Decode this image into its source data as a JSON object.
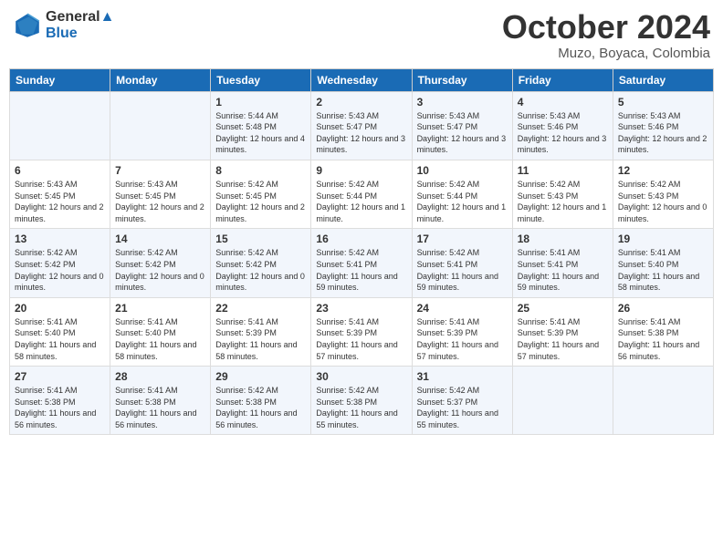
{
  "logo": {
    "line1": "General",
    "line2": "Blue"
  },
  "title": "October 2024",
  "subtitle": "Muzo, Boyaca, Colombia",
  "days_of_week": [
    "Sunday",
    "Monday",
    "Tuesday",
    "Wednesday",
    "Thursday",
    "Friday",
    "Saturday"
  ],
  "weeks": [
    [
      {
        "day": "",
        "sunrise": "",
        "sunset": "",
        "daylight": ""
      },
      {
        "day": "",
        "sunrise": "",
        "sunset": "",
        "daylight": ""
      },
      {
        "day": "1",
        "sunrise": "Sunrise: 5:44 AM",
        "sunset": "Sunset: 5:48 PM",
        "daylight": "Daylight: 12 hours and 4 minutes."
      },
      {
        "day": "2",
        "sunrise": "Sunrise: 5:43 AM",
        "sunset": "Sunset: 5:47 PM",
        "daylight": "Daylight: 12 hours and 3 minutes."
      },
      {
        "day": "3",
        "sunrise": "Sunrise: 5:43 AM",
        "sunset": "Sunset: 5:47 PM",
        "daylight": "Daylight: 12 hours and 3 minutes."
      },
      {
        "day": "4",
        "sunrise": "Sunrise: 5:43 AM",
        "sunset": "Sunset: 5:46 PM",
        "daylight": "Daylight: 12 hours and 3 minutes."
      },
      {
        "day": "5",
        "sunrise": "Sunrise: 5:43 AM",
        "sunset": "Sunset: 5:46 PM",
        "daylight": "Daylight: 12 hours and 2 minutes."
      }
    ],
    [
      {
        "day": "6",
        "sunrise": "Sunrise: 5:43 AM",
        "sunset": "Sunset: 5:45 PM",
        "daylight": "Daylight: 12 hours and 2 minutes."
      },
      {
        "day": "7",
        "sunrise": "Sunrise: 5:43 AM",
        "sunset": "Sunset: 5:45 PM",
        "daylight": "Daylight: 12 hours and 2 minutes."
      },
      {
        "day": "8",
        "sunrise": "Sunrise: 5:42 AM",
        "sunset": "Sunset: 5:45 PM",
        "daylight": "Daylight: 12 hours and 2 minutes."
      },
      {
        "day": "9",
        "sunrise": "Sunrise: 5:42 AM",
        "sunset": "Sunset: 5:44 PM",
        "daylight": "Daylight: 12 hours and 1 minute."
      },
      {
        "day": "10",
        "sunrise": "Sunrise: 5:42 AM",
        "sunset": "Sunset: 5:44 PM",
        "daylight": "Daylight: 12 hours and 1 minute."
      },
      {
        "day": "11",
        "sunrise": "Sunrise: 5:42 AM",
        "sunset": "Sunset: 5:43 PM",
        "daylight": "Daylight: 12 hours and 1 minute."
      },
      {
        "day": "12",
        "sunrise": "Sunrise: 5:42 AM",
        "sunset": "Sunset: 5:43 PM",
        "daylight": "Daylight: 12 hours and 0 minutes."
      }
    ],
    [
      {
        "day": "13",
        "sunrise": "Sunrise: 5:42 AM",
        "sunset": "Sunset: 5:42 PM",
        "daylight": "Daylight: 12 hours and 0 minutes."
      },
      {
        "day": "14",
        "sunrise": "Sunrise: 5:42 AM",
        "sunset": "Sunset: 5:42 PM",
        "daylight": "Daylight: 12 hours and 0 minutes."
      },
      {
        "day": "15",
        "sunrise": "Sunrise: 5:42 AM",
        "sunset": "Sunset: 5:42 PM",
        "daylight": "Daylight: 12 hours and 0 minutes."
      },
      {
        "day": "16",
        "sunrise": "Sunrise: 5:42 AM",
        "sunset": "Sunset: 5:41 PM",
        "daylight": "Daylight: 11 hours and 59 minutes."
      },
      {
        "day": "17",
        "sunrise": "Sunrise: 5:42 AM",
        "sunset": "Sunset: 5:41 PM",
        "daylight": "Daylight: 11 hours and 59 minutes."
      },
      {
        "day": "18",
        "sunrise": "Sunrise: 5:41 AM",
        "sunset": "Sunset: 5:41 PM",
        "daylight": "Daylight: 11 hours and 59 minutes."
      },
      {
        "day": "19",
        "sunrise": "Sunrise: 5:41 AM",
        "sunset": "Sunset: 5:40 PM",
        "daylight": "Daylight: 11 hours and 58 minutes."
      }
    ],
    [
      {
        "day": "20",
        "sunrise": "Sunrise: 5:41 AM",
        "sunset": "Sunset: 5:40 PM",
        "daylight": "Daylight: 11 hours and 58 minutes."
      },
      {
        "day": "21",
        "sunrise": "Sunrise: 5:41 AM",
        "sunset": "Sunset: 5:40 PM",
        "daylight": "Daylight: 11 hours and 58 minutes."
      },
      {
        "day": "22",
        "sunrise": "Sunrise: 5:41 AM",
        "sunset": "Sunset: 5:39 PM",
        "daylight": "Daylight: 11 hours and 58 minutes."
      },
      {
        "day": "23",
        "sunrise": "Sunrise: 5:41 AM",
        "sunset": "Sunset: 5:39 PM",
        "daylight": "Daylight: 11 hours and 57 minutes."
      },
      {
        "day": "24",
        "sunrise": "Sunrise: 5:41 AM",
        "sunset": "Sunset: 5:39 PM",
        "daylight": "Daylight: 11 hours and 57 minutes."
      },
      {
        "day": "25",
        "sunrise": "Sunrise: 5:41 AM",
        "sunset": "Sunset: 5:39 PM",
        "daylight": "Daylight: 11 hours and 57 minutes."
      },
      {
        "day": "26",
        "sunrise": "Sunrise: 5:41 AM",
        "sunset": "Sunset: 5:38 PM",
        "daylight": "Daylight: 11 hours and 56 minutes."
      }
    ],
    [
      {
        "day": "27",
        "sunrise": "Sunrise: 5:41 AM",
        "sunset": "Sunset: 5:38 PM",
        "daylight": "Daylight: 11 hours and 56 minutes."
      },
      {
        "day": "28",
        "sunrise": "Sunrise: 5:41 AM",
        "sunset": "Sunset: 5:38 PM",
        "daylight": "Daylight: 11 hours and 56 minutes."
      },
      {
        "day": "29",
        "sunrise": "Sunrise: 5:42 AM",
        "sunset": "Sunset: 5:38 PM",
        "daylight": "Daylight: 11 hours and 56 minutes."
      },
      {
        "day": "30",
        "sunrise": "Sunrise: 5:42 AM",
        "sunset": "Sunset: 5:38 PM",
        "daylight": "Daylight: 11 hours and 55 minutes."
      },
      {
        "day": "31",
        "sunrise": "Sunrise: 5:42 AM",
        "sunset": "Sunset: 5:37 PM",
        "daylight": "Daylight: 11 hours and 55 minutes."
      },
      {
        "day": "",
        "sunrise": "",
        "sunset": "",
        "daylight": ""
      },
      {
        "day": "",
        "sunrise": "",
        "sunset": "",
        "daylight": ""
      }
    ]
  ]
}
